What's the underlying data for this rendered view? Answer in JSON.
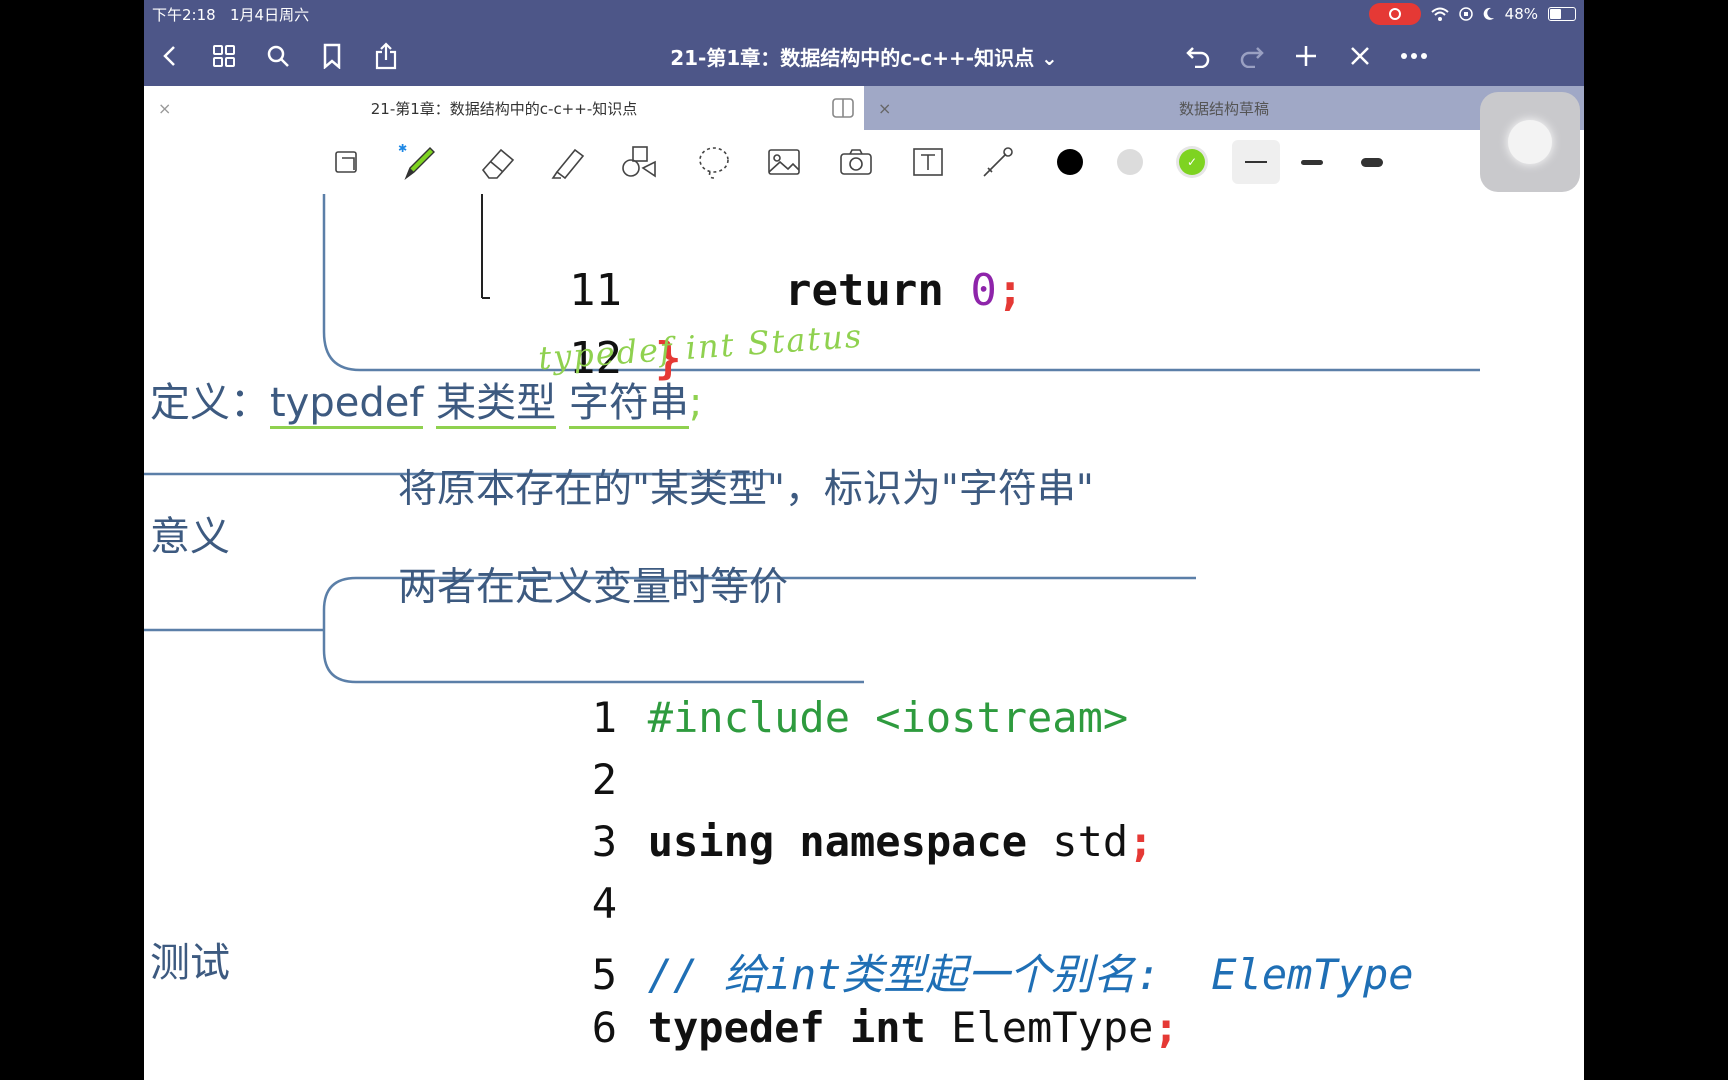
{
  "status_bar": {
    "time": "下午2:18",
    "date": "1月4日周六",
    "battery": "48%"
  },
  "nav": {
    "title": "21-第1章：数据结构中的c-c++-知识点 ⌄",
    "icons": [
      "back-icon",
      "grid-icon",
      "search-icon",
      "bookmark-icon",
      "share-icon",
      "undo-icon",
      "redo-icon",
      "plus-icon",
      "close-icon",
      "more-icon"
    ]
  },
  "tabs": [
    {
      "label": "21-第1章：数据结构中的c-c++-知识点",
      "close": "×"
    },
    {
      "label": "数据结构草稿",
      "close": "×"
    }
  ],
  "toolbar": {
    "tools": [
      "lasso-page-icon",
      "pen-icon",
      "eraser-icon",
      "highlighter-icon",
      "shapes-icon",
      "lasso-icon",
      "image-icon",
      "camera-icon",
      "text-icon",
      "laser-icon"
    ],
    "colors": [
      "#000000",
      "#dcdcdc",
      "#7ed321"
    ],
    "line_widths": [
      "thin",
      "medium",
      "thick"
    ]
  },
  "page": {
    "code_top": [
      {
        "num": "11",
        "code": "return",
        "val": "0",
        "semi": ";"
      },
      {
        "num": "12",
        "brace": "}"
      }
    ],
    "handwriting": "typedef int Status",
    "definition": {
      "label": "定义：",
      "kw": "typedef",
      "type_word": "某类型",
      "alias_word": "字符串",
      "semi": ";"
    },
    "meaning": {
      "label": "意义",
      "line1": "将原本存在的\"某类型\"，标识为\"字符串\"",
      "line2": "两者在定义变量时等价"
    },
    "test_label": "测试",
    "code_bottom": [
      {
        "num": "1",
        "text": "#include <iostream>"
      },
      {
        "num": "2",
        "text": ""
      },
      {
        "num": "3",
        "kw": "using namespace",
        "rest": " std",
        "semi": ";"
      },
      {
        "num": "4",
        "text": ""
      },
      {
        "num": "5",
        "comment": "// 给int类型起一个别名:  ElemType"
      },
      {
        "num": "6",
        "kw": "typedef int",
        "rest": " ElemType",
        "semi": ";"
      }
    ]
  }
}
